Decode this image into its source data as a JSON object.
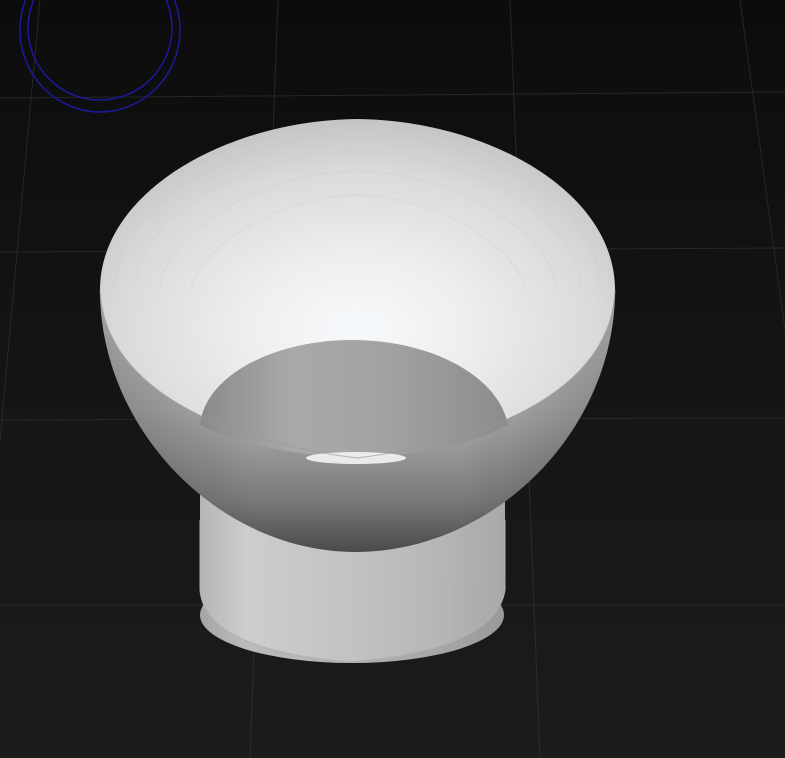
{
  "viewport": {
    "background_color": "#121212",
    "grid_color": "#3a3a3a",
    "show_grid": true
  },
  "gizmo": {
    "icon": "orbit-gizmo-icon",
    "color": "#1a1a9c"
  },
  "model": {
    "shape": "bowl-on-cylindrical-stem",
    "base_color": "#d8d8d8"
  }
}
